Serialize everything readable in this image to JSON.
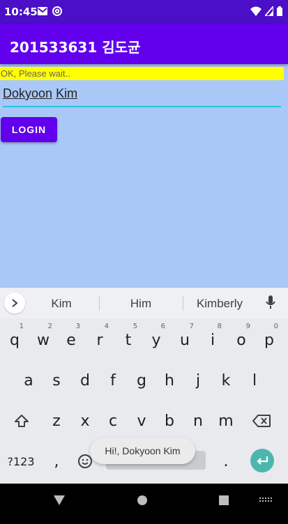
{
  "status_bar": {
    "time": "10:45",
    "left_icons": [
      "mail-icon",
      "at-sign-icon"
    ],
    "right_icons": [
      "wifi-icon",
      "signal-icon",
      "battery-icon"
    ]
  },
  "app_bar": {
    "title": "201533631 김도균"
  },
  "form": {
    "status_text": "OK, Please wait..",
    "name_value_first": "Dokyoon",
    "name_value_last": "Kim",
    "login_label": "LOGIN"
  },
  "keyboard": {
    "suggestions": [
      "Kim",
      "Him",
      "Kimberly"
    ],
    "row1": [
      {
        "key": "q",
        "hint": "1"
      },
      {
        "key": "w",
        "hint": "2"
      },
      {
        "key": "e",
        "hint": "3"
      },
      {
        "key": "r",
        "hint": "4"
      },
      {
        "key": "t",
        "hint": "5"
      },
      {
        "key": "y",
        "hint": "6"
      },
      {
        "key": "u",
        "hint": "7"
      },
      {
        "key": "i",
        "hint": "8"
      },
      {
        "key": "o",
        "hint": "9"
      },
      {
        "key": "p",
        "hint": "0"
      }
    ],
    "row2": [
      "a",
      "s",
      "d",
      "f",
      "g",
      "h",
      "j",
      "k",
      "l"
    ],
    "row3": [
      "z",
      "x",
      "c",
      "v",
      "b",
      "n",
      "m"
    ],
    "symbols_label": "?123",
    "comma": ",",
    "period": "."
  },
  "toast": {
    "text": "Hi!, Dokyoon Kim"
  },
  "colors": {
    "status_bar": "#4a0fc7",
    "app_bar": "#6200ee",
    "background": "#aac8f7",
    "banner": "#ffff00",
    "accent": "#26c6da",
    "enter": "#4db6ac"
  }
}
